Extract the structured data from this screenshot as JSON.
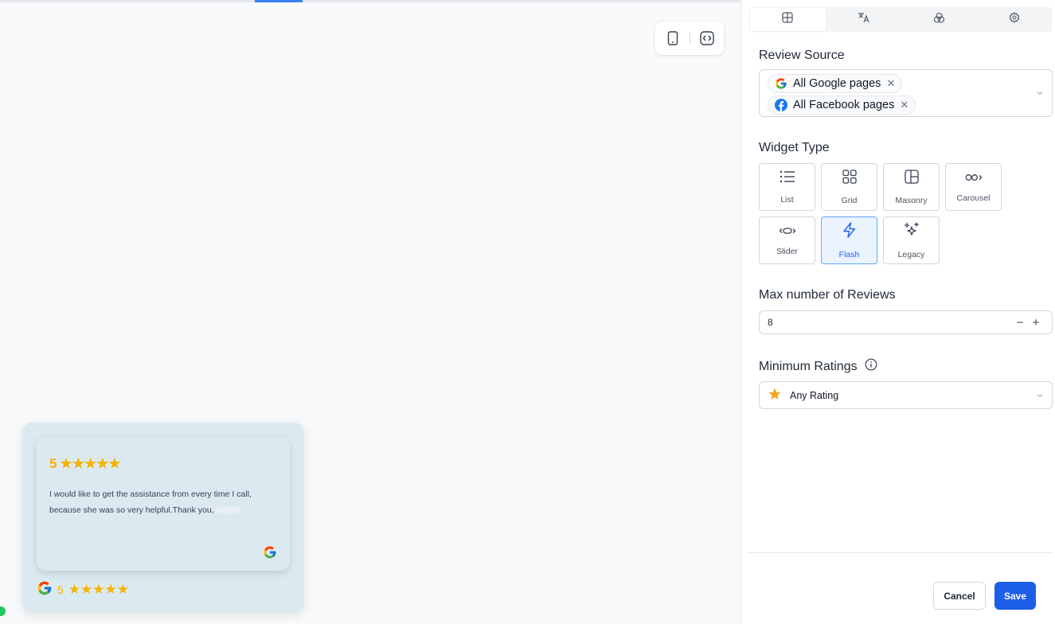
{
  "preview": {
    "widget": {
      "card": {
        "rating": "5",
        "stars": "★★★★★",
        "text": "I would like to get the assistance from every time I call, because she was so very helpful.Thank you,",
        "source_icon": "google-icon"
      },
      "summary": {
        "rating": "5",
        "stars": "★★★★★"
      }
    },
    "device_toggle": {
      "icons": [
        "mobile-icon",
        "code-icon"
      ]
    }
  },
  "panel": {
    "tabs": [
      {
        "icon": "layout-icon",
        "active": true
      },
      {
        "icon": "translate-icon",
        "active": false
      },
      {
        "icon": "palette-icon",
        "active": false
      },
      {
        "icon": "settings-icon",
        "active": false
      }
    ],
    "review_source": {
      "title": "Review Source",
      "chips": [
        {
          "label": "All Google pages",
          "icon": "google-icon"
        },
        {
          "label": "All Facebook pages",
          "icon": "facebook-icon"
        }
      ]
    },
    "widget_type": {
      "title": "Widget Type",
      "options": [
        {
          "label": "List",
          "icon": "list-icon",
          "active": false
        },
        {
          "label": "Grid",
          "icon": "grid-icon",
          "active": false
        },
        {
          "label": "Masonry",
          "icon": "masonry-icon",
          "active": false
        },
        {
          "label": "Carousel",
          "icon": "carousel-icon",
          "active": false
        },
        {
          "label": "Slider",
          "icon": "slider-icon",
          "active": false
        },
        {
          "label": "Flash",
          "icon": "flash-icon",
          "active": true
        },
        {
          "label": "Legacy",
          "icon": "sparkles-icon",
          "active": false
        }
      ]
    },
    "max_reviews": {
      "title": "Max number of Reviews",
      "value": "8",
      "minus": "−",
      "plus": "+"
    },
    "min_rating": {
      "title": "Minimum Ratings",
      "value": "Any Rating"
    },
    "footer": {
      "cancel": "Cancel",
      "save": "Save"
    },
    "colors": {
      "accent": "#1d5ee8",
      "star": "#f5b300",
      "active_bg": "#eaf3fe"
    }
  }
}
